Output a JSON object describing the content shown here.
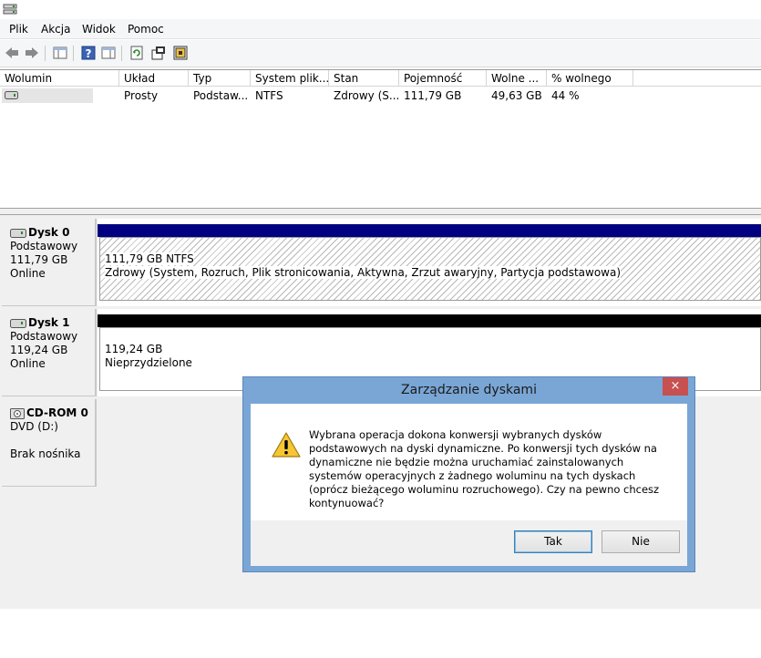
{
  "menu": {
    "items": [
      "Plik",
      "Akcja",
      "Widok",
      "Pomoc"
    ]
  },
  "toolbar": {
    "icons": [
      "back-arrow-icon",
      "forward-arrow-icon",
      "console-tree-icon",
      "help-icon",
      "action-pane-icon",
      "refresh-icon",
      "properties-icon",
      "settings-icon"
    ]
  },
  "volumes": {
    "headers": [
      "Wolumin",
      "Układ",
      "Typ",
      "System plik...",
      "Stan",
      "Pojemność",
      "Wolne ...",
      "% wolnego"
    ],
    "rows": [
      {
        "volume": "",
        "layout": "Prosty",
        "type": "Podstaw...",
        "fs": "NTFS",
        "status": "Zdrowy (S...",
        "capacity": "111,79 GB",
        "free": "49,63 GB",
        "pct": "44 %"
      }
    ]
  },
  "disks": [
    {
      "name": "Dysk 0",
      "type": "Podstawowy",
      "size": "111,79 GB",
      "state": "Online",
      "bar_color": "#000080",
      "partition": {
        "line1": "111,79 GB NTFS",
        "line2": "Zdrowy (System, Rozruch, Plik stronicowania, Aktywna, Zrzut awaryjny, Partycja podstawowa)"
      }
    },
    {
      "name": "Dysk 1",
      "type": "Podstawowy",
      "size": "119,24 GB",
      "state": "Online",
      "bar_color": "#000000",
      "partition": {
        "line1": "119,24 GB",
        "line2": "Nieprzydzielone"
      }
    },
    {
      "name": "CD-ROM 0",
      "type": "DVD (D:)",
      "size": "",
      "state": "Brak nośnika"
    }
  ],
  "dialog": {
    "title": "Zarządzanie dyskami",
    "close_label": "×",
    "message": "Wybrana operacja dokona konwersji wybranych dysków podstawowych na dyski dynamiczne. Po konwersji tych dysków na dynamiczne nie będzie można uruchamiać zainstalowanych systemów operacyjnych z żadnego woluminu na tych dyskach (oprócz bieżącego woluminu rozruchowego). Czy na pewno chcesz kontynuować?",
    "yes_label": "Tak",
    "no_label": "Nie"
  },
  "colors": {
    "dialog_frame": "#7aa6d6",
    "close_button": "#c75050",
    "primary_partition": "#000080",
    "unallocated": "#000000"
  }
}
